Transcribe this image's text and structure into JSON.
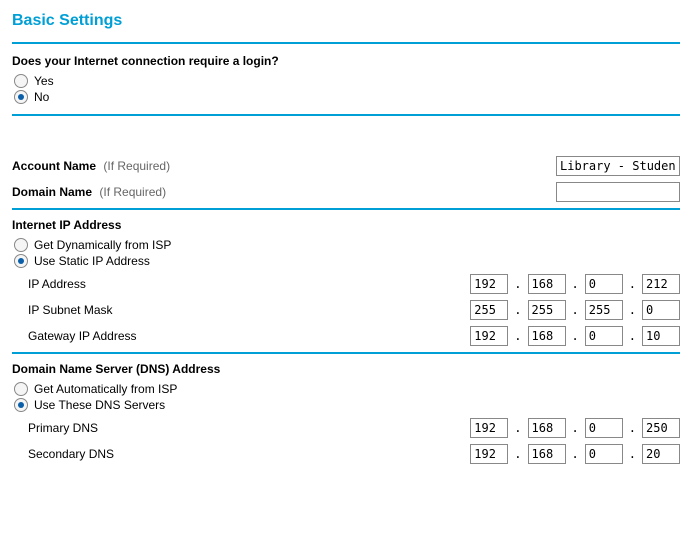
{
  "title": "Basic Settings",
  "login_question": "Does your Internet connection require a login?",
  "login_yes": "Yes",
  "login_no": "No",
  "login_selected": "no",
  "account_name_label": "Account Name",
  "domain_name_label": "Domain Name",
  "if_required": "(If Required)",
  "account_name_value": "Library - Student",
  "domain_name_value": "",
  "internet_ip_header": "Internet IP Address",
  "ip_dynamic_label": "Get Dynamically from ISP",
  "ip_static_label": "Use Static IP Address",
  "ip_selected": "static",
  "ip_address_label": "IP Address",
  "ip_subnet_label": "IP Subnet Mask",
  "gateway_label": "Gateway IP Address",
  "ip_address": {
    "a": "192",
    "b": "168",
    "c": "0",
    "d": "212"
  },
  "subnet": {
    "a": "255",
    "b": "255",
    "c": "255",
    "d": "0"
  },
  "gateway": {
    "a": "192",
    "b": "168",
    "c": "0",
    "d": "10"
  },
  "dns_header": "Domain Name Server (DNS) Address",
  "dns_auto_label": "Get Automatically from ISP",
  "dns_use_label": "Use These DNS Servers",
  "dns_selected": "use",
  "primary_dns_label": "Primary DNS",
  "secondary_dns_label": "Secondary DNS",
  "primary_dns": {
    "a": "192",
    "b": "168",
    "c": "0",
    "d": "250"
  },
  "secondary_dns": {
    "a": "192",
    "b": "168",
    "c": "0",
    "d": "20"
  }
}
